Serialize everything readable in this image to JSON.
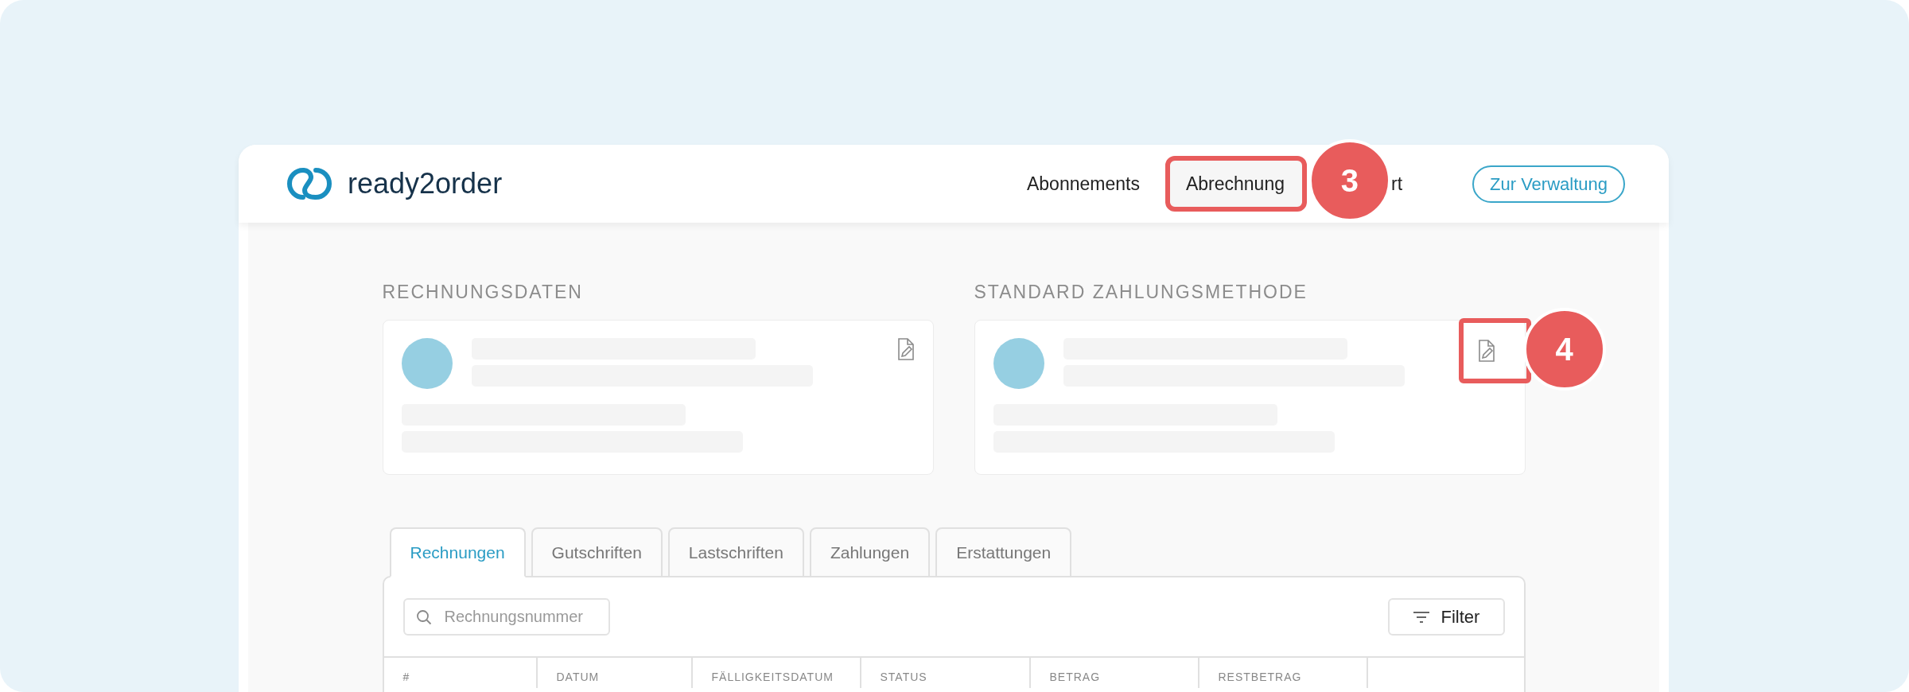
{
  "logo": {
    "text": "ready2order"
  },
  "nav": [
    {
      "label": "Abonnements",
      "highlighted": false
    },
    {
      "label": "Abrechnung",
      "highlighted": true,
      "badge": "3"
    },
    {
      "label": "rt",
      "highlighted": false
    }
  ],
  "header_button": "Zur Verwaltung",
  "sections": [
    {
      "title": "RECHNUNGSDATEN",
      "highlighted": false
    },
    {
      "title": "STANDARD ZAHLUNGSMETHODE",
      "highlighted": true,
      "badge": "4"
    }
  ],
  "tabs": [
    {
      "label": "Rechnungen",
      "selected": true
    },
    {
      "label": "Gutschriften",
      "selected": false
    },
    {
      "label": "Lastschriften",
      "selected": false
    },
    {
      "label": "Zahlungen",
      "selected": false
    },
    {
      "label": "Erstattungen",
      "selected": false
    }
  ],
  "search": {
    "placeholder": "Rechnungsnummer"
  },
  "filter_button": "Filter",
  "table": {
    "columns": [
      "#",
      "DATUM",
      "FÄLLIGKEITSDATUM",
      "STATUS",
      "BETRAG",
      "RESTBETRAG"
    ]
  }
}
